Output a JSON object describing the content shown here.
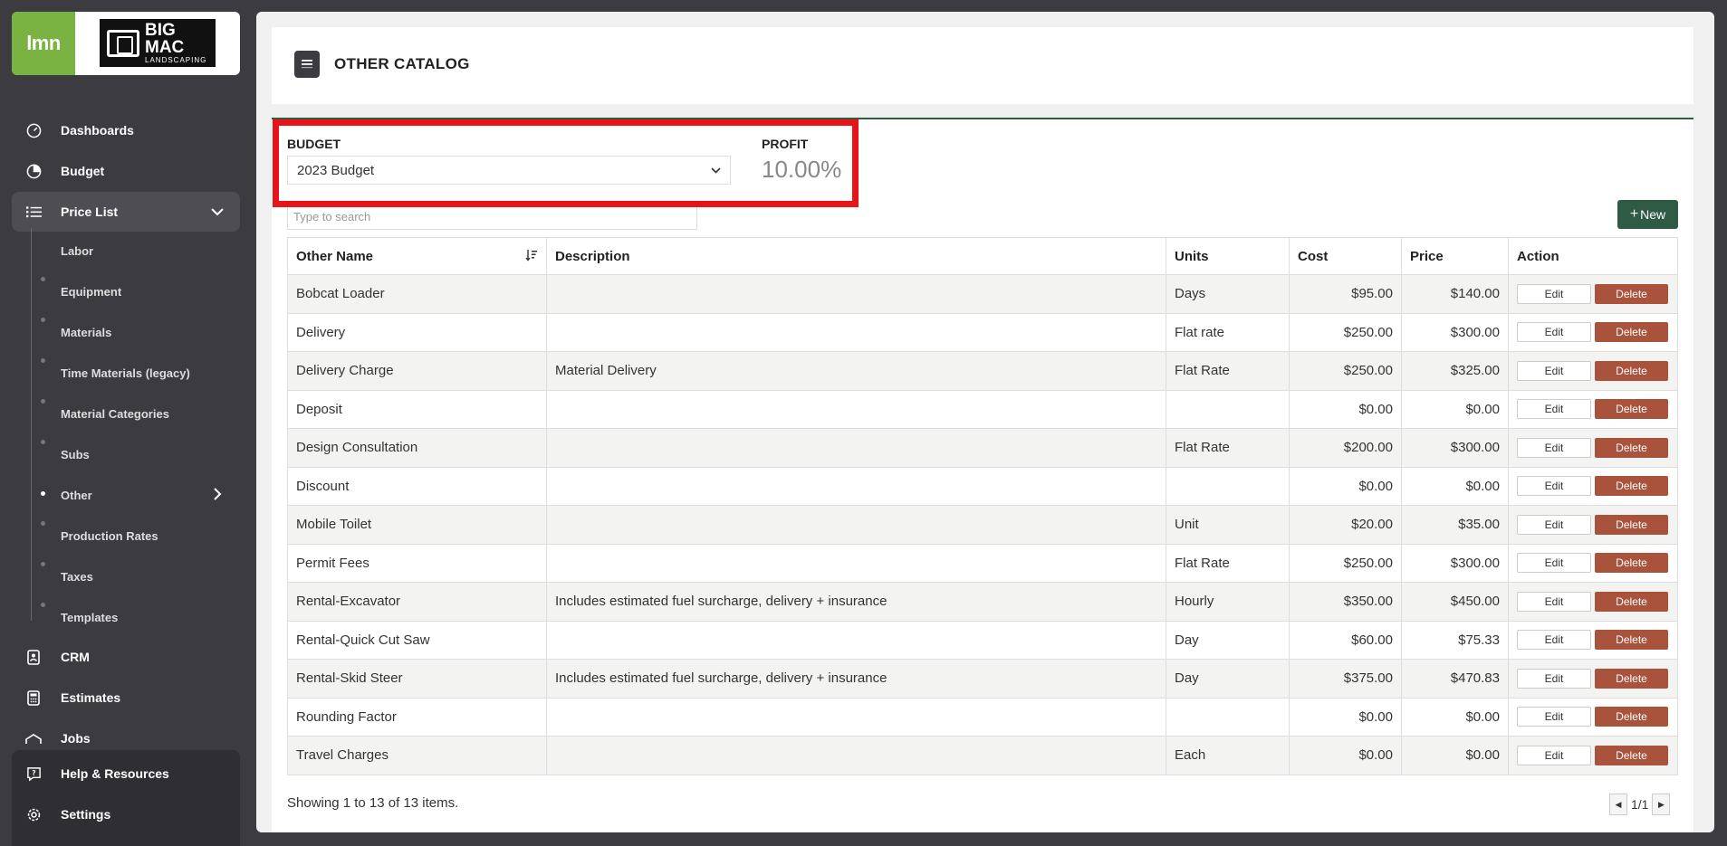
{
  "brand": {
    "app_logo_text": "lmn",
    "company_line1": "BIG",
    "company_line2": "MAC",
    "company_line3": "LANDSCAPING",
    "app_color": "#7ab342"
  },
  "sidebar": {
    "items": [
      {
        "label": "Dashboards",
        "icon": "gauge-icon"
      },
      {
        "label": "Budget",
        "icon": "pie-chart-icon"
      },
      {
        "label": "Price List",
        "icon": "list-icon"
      },
      {
        "label": "CRM",
        "icon": "contact-book-icon"
      },
      {
        "label": "Estimates",
        "icon": "calculator-icon"
      },
      {
        "label": "Jobs",
        "icon": "jobs-icon"
      },
      {
        "label": "Help & Resources",
        "icon": "help-icon"
      },
      {
        "label": "Settings",
        "icon": "gear-icon"
      }
    ],
    "price_list_sub": [
      {
        "label": "Labor"
      },
      {
        "label": "Equipment"
      },
      {
        "label": "Materials"
      },
      {
        "label": "Time Materials (legacy)"
      },
      {
        "label": "Material Categories"
      },
      {
        "label": "Subs"
      },
      {
        "label": "Other"
      },
      {
        "label": "Production Rates"
      },
      {
        "label": "Taxes"
      },
      {
        "label": "Templates"
      }
    ]
  },
  "page": {
    "title": "OTHER CATALOG"
  },
  "budget": {
    "label": "BUDGET",
    "selected": "2023 Budget",
    "profit_label": "PROFIT",
    "profit_value": "10.00%"
  },
  "search": {
    "placeholder": "Type to search"
  },
  "new_button": "New",
  "table": {
    "headers": [
      "Other Name",
      "Description",
      "Units",
      "Cost",
      "Price",
      "Action"
    ],
    "edit_label": "Edit",
    "delete_label": "Delete",
    "rows": [
      {
        "name": "Bobcat Loader",
        "description": "",
        "units": "Days",
        "cost": "$95.00",
        "price": "$140.00"
      },
      {
        "name": "Delivery",
        "description": "",
        "units": "Flat rate",
        "cost": "$250.00",
        "price": "$300.00"
      },
      {
        "name": "Delivery Charge",
        "description": "Material Delivery",
        "units": "Flat Rate",
        "cost": "$250.00",
        "price": "$325.00"
      },
      {
        "name": "Deposit",
        "description": "",
        "units": "",
        "cost": "$0.00",
        "price": "$0.00"
      },
      {
        "name": "Design Consultation",
        "description": "",
        "units": "Flat Rate",
        "cost": "$200.00",
        "price": "$300.00"
      },
      {
        "name": "Discount",
        "description": "",
        "units": "",
        "cost": "$0.00",
        "price": "$0.00"
      },
      {
        "name": "Mobile Toilet",
        "description": "",
        "units": "Unit",
        "cost": "$20.00",
        "price": "$35.00"
      },
      {
        "name": "Permit Fees",
        "description": "",
        "units": "Flat Rate",
        "cost": "$250.00",
        "price": "$300.00"
      },
      {
        "name": "Rental-Excavator",
        "description": "Includes estimated fuel surcharge, delivery + insurance",
        "units": "Hourly",
        "cost": "$350.00",
        "price": "$450.00"
      },
      {
        "name": "Rental-Quick Cut Saw",
        "description": "",
        "units": "Day",
        "cost": "$60.00",
        "price": "$75.33"
      },
      {
        "name": "Rental-Skid Steer",
        "description": "Includes estimated fuel surcharge, delivery + insurance",
        "units": "Day",
        "cost": "$375.00",
        "price": "$470.83"
      },
      {
        "name": "Rounding Factor",
        "description": "",
        "units": "",
        "cost": "$0.00",
        "price": "$0.00"
      },
      {
        "name": "Travel Charges",
        "description": "",
        "units": "Each",
        "cost": "$0.00",
        "price": "$0.00"
      }
    ]
  },
  "footer": {
    "showing": "Showing 1 to 13 of 13 items.",
    "page_indicator": "1/1"
  }
}
